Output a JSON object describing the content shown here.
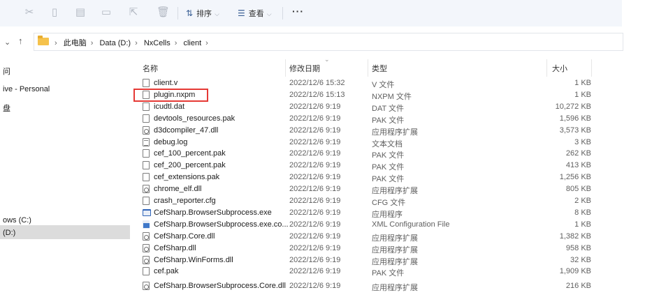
{
  "toolbar": {
    "sort_label": "排序",
    "view_label": "查看",
    "more_label": "···"
  },
  "address": {
    "up_arrow": "↑",
    "crumbs": [
      "此电脑",
      "Data (D:)",
      "NxCells",
      "client"
    ]
  },
  "nav": {
    "items": [
      "问",
      "ive - Personal",
      "盘",
      "ows (C:)",
      "(D:)"
    ]
  },
  "columns": {
    "name": "名称",
    "date": "修改日期",
    "type": "类型",
    "size": "大小"
  },
  "files": [
    {
      "name": "client.v",
      "date": "2022/12/6 15:32",
      "type": "V 文件",
      "size": "1 KB",
      "icon": "file"
    },
    {
      "name": "plugin.nxpm",
      "date": "2022/12/6 15:13",
      "type": "NXPM 文件",
      "size": "1 KB",
      "icon": "file"
    },
    {
      "name": "icudtl.dat",
      "date": "2022/12/6 9:19",
      "type": "DAT 文件",
      "size": "10,272 KB",
      "icon": "file"
    },
    {
      "name": "devtools_resources.pak",
      "date": "2022/12/6 9:19",
      "type": "PAK 文件",
      "size": "1,596 KB",
      "icon": "file"
    },
    {
      "name": "d3dcompiler_47.dll",
      "date": "2022/12/6 9:19",
      "type": "应用程序扩展",
      "size": "3,573 KB",
      "icon": "dll"
    },
    {
      "name": "debug.log",
      "date": "2022/12/6 9:19",
      "type": "文本文档",
      "size": "3 KB",
      "icon": "log"
    },
    {
      "name": "cef_100_percent.pak",
      "date": "2022/12/6 9:19",
      "type": "PAK 文件",
      "size": "262 KB",
      "icon": "file"
    },
    {
      "name": "cef_200_percent.pak",
      "date": "2022/12/6 9:19",
      "type": "PAK 文件",
      "size": "413 KB",
      "icon": "file"
    },
    {
      "name": "cef_extensions.pak",
      "date": "2022/12/6 9:19",
      "type": "PAK 文件",
      "size": "1,256 KB",
      "icon": "file"
    },
    {
      "name": "chrome_elf.dll",
      "date": "2022/12/6 9:19",
      "type": "应用程序扩展",
      "size": "805 KB",
      "icon": "dll"
    },
    {
      "name": "crash_reporter.cfg",
      "date": "2022/12/6 9:19",
      "type": "CFG 文件",
      "size": "2 KB",
      "icon": "file"
    },
    {
      "name": "CefSharp.BrowserSubprocess.exe",
      "date": "2022/12/6 9:19",
      "type": "应用程序",
      "size": "8 KB",
      "icon": "exe"
    },
    {
      "name": "CefSharp.BrowserSubprocess.exe.co...",
      "date": "2022/12/6 9:19",
      "type": "XML Configuration File",
      "size": "1 KB",
      "icon": "xml"
    },
    {
      "name": "CefSharp.Core.dll",
      "date": "2022/12/6 9:19",
      "type": "应用程序扩展",
      "size": "1,382 KB",
      "icon": "dll"
    },
    {
      "name": "CefSharp.dll",
      "date": "2022/12/6 9:19",
      "type": "应用程序扩展",
      "size": "958 KB",
      "icon": "dll"
    },
    {
      "name": "CefSharp.WinForms.dll",
      "date": "2022/12/6 9:19",
      "type": "应用程序扩展",
      "size": "32 KB",
      "icon": "dll"
    },
    {
      "name": "cef.pak",
      "date": "2022/12/6 9:19",
      "type": "PAK 文件",
      "size": "1,909 KB",
      "icon": "file"
    }
  ],
  "partial_row": {
    "name": "CefSharp.BrowserSubprocess.Core.dll",
    "date": "2022/12/6 9:19",
    "type": "应用程序扩展",
    "size": "216 KB"
  },
  "highlight_color": "#e53935"
}
